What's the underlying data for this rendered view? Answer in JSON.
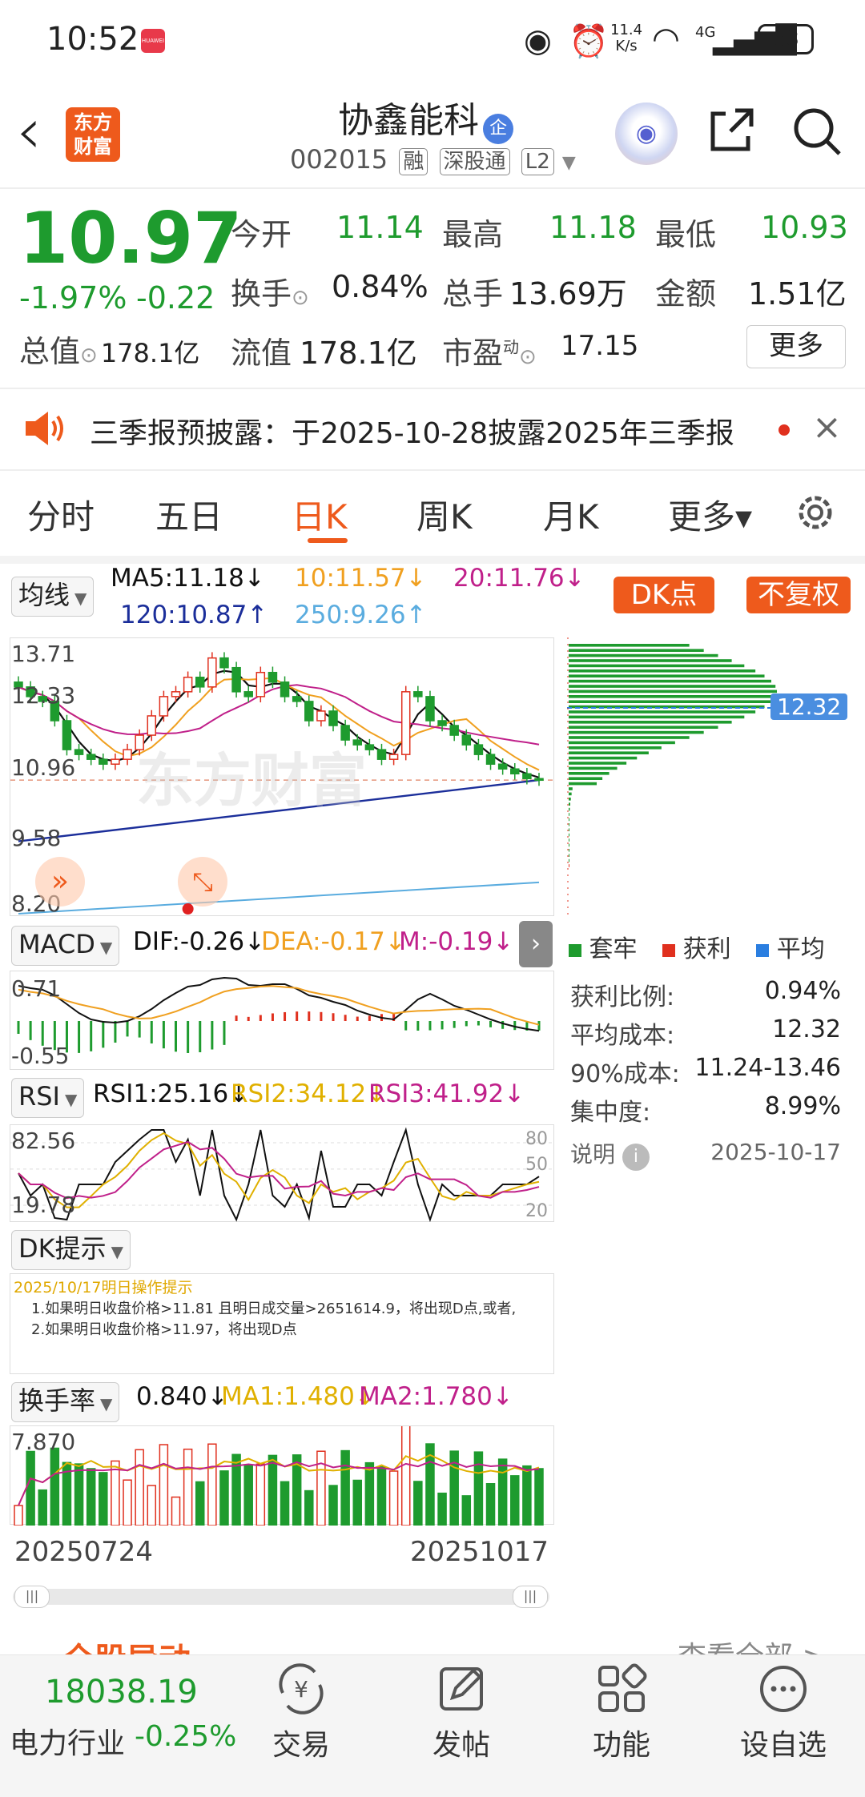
{
  "status": {
    "time": "10:52",
    "speed": "11.4",
    "speed_unit": "K/s",
    "net": "4G",
    "battery": "68",
    "app_badge": "HUAWEI"
  },
  "header": {
    "back": "‹",
    "logo_line1": "东方",
    "logo_line2": "财富",
    "name": "协鑫能科",
    "badge": "企",
    "code": "002015",
    "tag1": "融",
    "tag2": "深股通",
    "tag3": "L2"
  },
  "quote": {
    "price": "10.97",
    "pct": "-1.97%",
    "chg": "-0.22",
    "open_l": "今开",
    "open_v": "11.14",
    "high_l": "最高",
    "high_v": "11.18",
    "low_l": "最低",
    "low_v": "10.93",
    "turn_l": "换手",
    "turn_v": "0.84%",
    "vol_l": "总手",
    "vol_v": "13.69万",
    "amt_l": "金额",
    "amt_v": "1.51亿",
    "mcap_l": "总值",
    "mcap_v": "178.1亿",
    "float_l": "流值",
    "float_v": "178.1亿",
    "pe_l": "市盈",
    "pe_sup": "动",
    "pe_v": "17.15",
    "more": "更多"
  },
  "notice": {
    "text": "三季报预披露：于2025-10-28披露2025年三季报",
    "close": "×"
  },
  "tabs": {
    "t1": "分时",
    "t2": "五日",
    "t3": "日K",
    "t4": "周K",
    "t5": "月K",
    "t6": "更多▾"
  },
  "kline": {
    "sel": "均线",
    "ma5": "MA5:11.18↓",
    "ma10": "10:11.57↓",
    "ma20": "20:11.76↓",
    "ma120": "120:10.87↑",
    "ma250": "250:9.26↑",
    "dk_btn": "DK点",
    "adj_btn": "不复权",
    "y1": "13.71",
    "y2": "12.33",
    "y3": "10.96",
    "y4": "9.58",
    "y5": "8.20",
    "chip_price": "12.32",
    "watermark": "东方财富"
  },
  "macd": {
    "sel": "MACD",
    "dif": "DIF:-0.26↓",
    "dea": "DEA:-0.17↓",
    "m": "M:-0.19↓",
    "y1": "0.71",
    "y2": "-0.55"
  },
  "rsi": {
    "sel": "RSI",
    "r1": "RSI1:25.16↓",
    "r2": "RSI2:34.12↓",
    "r3": "RSI3:41.92↓",
    "y1": "82.56",
    "y2": "19.78",
    "g1": "80",
    "g2": "50",
    "g3": "20"
  },
  "dk": {
    "sel": "DK提示",
    "date": "2025/10/17明日操作提示",
    "l1": "1.如果明日收盘价格>11.81 且明日成交量>2651614.9，将出现D点,或者,",
    "l2": "2.如果明日收盘价格>11.97，将出现D点"
  },
  "turnover": {
    "sel": "换手率",
    "val": "0.840↓",
    "ma1": "MA1:1.480↓",
    "ma2": "MA2:1.780↓",
    "y1": "7.870",
    "d1": "20250724",
    "d2": "20251017"
  },
  "chips": {
    "leg1": "套牢",
    "leg2": "获利",
    "leg3": "平均",
    "r1l": "获利比例:",
    "r1v": "0.94%",
    "r2l": "平均成本:",
    "r2v": "12.32",
    "r3l": "90%成本:",
    "r3v": "11.24-13.46",
    "r4l": "集中度:",
    "r4v": "8.99%",
    "note": "说明",
    "date": "2025-10-17"
  },
  "bottom": {
    "index": "18038.19",
    "sector": "电力行业",
    "sector_pct": "-0.25%",
    "n1": "交易",
    "n2": "发帖",
    "n3": "功能",
    "n4": "设自选",
    "cut_left": "全股异动",
    "cut_right": "查看全部 >"
  },
  "colors": {
    "up": "#e0301e",
    "down": "#1e9b2e",
    "accent": "#ee5a1c",
    "ma5": "#111",
    "ma10": "#f0a020",
    "ma20": "#c0208a",
    "ma120": "#1b2e9a",
    "ma250": "#5aacdf"
  },
  "chart_data": {
    "type": "candlestick",
    "ylim": [
      8.2,
      13.71
    ],
    "x_range": [
      "20250724",
      "20251017"
    ],
    "closes": [
      12.9,
      12.7,
      12.6,
      12.2,
      11.6,
      11.5,
      11.4,
      11.3,
      11.4,
      11.6,
      11.9,
      12.3,
      12.7,
      12.8,
      13.1,
      12.9,
      13.5,
      13.3,
      12.8,
      12.7,
      13.2,
      13.0,
      12.7,
      12.6,
      12.2,
      12.4,
      12.1,
      11.8,
      11.7,
      11.6,
      11.4,
      11.5,
      12.8,
      12.7,
      12.2,
      12.1,
      11.9,
      11.7,
      11.5,
      11.3,
      11.2,
      11.1,
      11.0,
      10.97
    ]
  }
}
